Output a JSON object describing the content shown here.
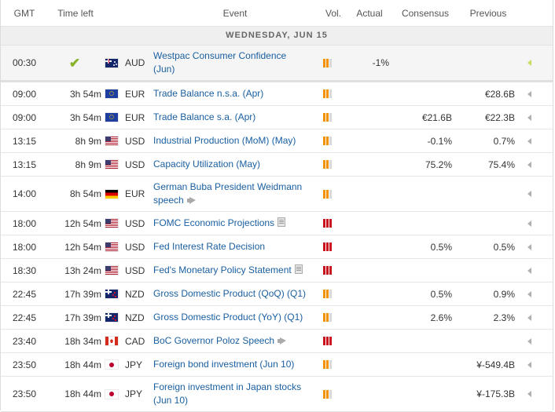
{
  "columns": {
    "gmt": "GMT",
    "time_left": "Time left",
    "event": "Event",
    "vol": "Vol.",
    "actual": "Actual",
    "consensus": "Consensus",
    "previous": "Previous"
  },
  "day_label": "WEDNESDAY, JUN 15",
  "colors": {
    "volatility_medium": "#f29200",
    "volatility_high": "#c8141e",
    "volatility_off": "#d9d9d9",
    "event_link": "#1a5fa0",
    "check": "#8bb32b"
  },
  "rows": [
    {
      "gmt": "00:30",
      "time_left": "",
      "done": true,
      "flag": "au",
      "currency": "AUD",
      "event_line1": "Westpac Consumer Confidence",
      "event_line2": "(Jun)",
      "icon": "",
      "vol": "medium",
      "actual": "-1%",
      "consensus": "",
      "previous": ""
    },
    {
      "gmt": "09:00",
      "time_left": "3h 54m",
      "flag": "eu",
      "currency": "EUR",
      "event_line1": "Trade Balance n.s.a. (Apr)",
      "event_line2": "",
      "icon": "",
      "vol": "medium",
      "actual": "",
      "consensus": "",
      "previous": "€28.6B"
    },
    {
      "gmt": "09:00",
      "time_left": "3h 54m",
      "flag": "eu",
      "currency": "EUR",
      "event_line1": "Trade Balance s.a. (Apr)",
      "event_line2": "",
      "icon": "",
      "vol": "medium",
      "actual": "",
      "consensus": "€21.6B",
      "previous": "€22.3B"
    },
    {
      "gmt": "13:15",
      "time_left": "8h 9m",
      "flag": "us",
      "currency": "USD",
      "event_line1": "Industrial Production (MoM) (May)",
      "event_line2": "",
      "icon": "",
      "vol": "medium",
      "actual": "",
      "consensus": "-0.1%",
      "previous": "0.7%"
    },
    {
      "gmt": "13:15",
      "time_left": "8h 9m",
      "flag": "us",
      "currency": "USD",
      "event_line1": "Capacity Utilization (May)",
      "event_line2": "",
      "icon": "",
      "vol": "medium",
      "actual": "",
      "consensus": "75.2%",
      "previous": "75.4%"
    },
    {
      "gmt": "14:00",
      "time_left": "8h 54m",
      "flag": "de",
      "currency": "EUR",
      "event_line1": "German Buba President Weidmann",
      "event_line2": "speech",
      "icon": "speech",
      "vol": "medium",
      "actual": "",
      "consensus": "",
      "previous": ""
    },
    {
      "gmt": "18:00",
      "time_left": "12h 54m",
      "flag": "us",
      "currency": "USD",
      "event_line1": "FOMC Economic Projections",
      "event_line2": "",
      "icon": "note",
      "vol": "high",
      "actual": "",
      "consensus": "",
      "previous": ""
    },
    {
      "gmt": "18:00",
      "time_left": "12h 54m",
      "flag": "us",
      "currency": "USD",
      "event_line1": "Fed Interest Rate Decision",
      "event_line2": "",
      "icon": "",
      "vol": "high",
      "actual": "",
      "consensus": "0.5%",
      "previous": "0.5%"
    },
    {
      "gmt": "18:30",
      "time_left": "13h 24m",
      "flag": "us",
      "currency": "USD",
      "event_line1": "Fed's Monetary Policy Statement",
      "event_line2": "",
      "icon": "note",
      "vol": "high",
      "actual": "",
      "consensus": "",
      "previous": ""
    },
    {
      "gmt": "22:45",
      "time_left": "17h 39m",
      "flag": "nz",
      "currency": "NZD",
      "event_line1": "Gross Domestic Product (QoQ) (Q1)",
      "event_line2": "",
      "icon": "",
      "vol": "medium",
      "actual": "",
      "consensus": "0.5%",
      "previous": "0.9%"
    },
    {
      "gmt": "22:45",
      "time_left": "17h 39m",
      "flag": "nz",
      "currency": "NZD",
      "event_line1": "Gross Domestic Product (YoY) (Q1)",
      "event_line2": "",
      "icon": "",
      "vol": "medium",
      "actual": "",
      "consensus": "2.6%",
      "previous": "2.3%"
    },
    {
      "gmt": "23:40",
      "time_left": "18h 34m",
      "flag": "ca",
      "currency": "CAD",
      "event_line1": "BoC Governor Poloz Speech",
      "event_line2": "",
      "icon": "speech",
      "vol": "high",
      "actual": "",
      "consensus": "",
      "previous": ""
    },
    {
      "gmt": "23:50",
      "time_left": "18h 44m",
      "flag": "jp",
      "currency": "JPY",
      "event_line1": "Foreign bond investment (Jun 10)",
      "event_line2": "",
      "icon": "",
      "vol": "medium",
      "actual": "",
      "consensus": "",
      "previous": "¥-549.4B"
    },
    {
      "gmt": "23:50",
      "time_left": "18h 44m",
      "flag": "jp",
      "currency": "JPY",
      "event_line1": "Foreign investment in Japan stocks",
      "event_line2": "(Jun 10)",
      "icon": "",
      "vol": "medium",
      "actual": "",
      "consensus": "",
      "previous": "¥-175.3B"
    }
  ]
}
